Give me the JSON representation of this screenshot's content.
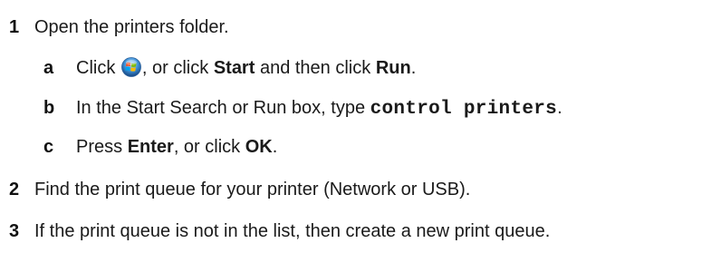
{
  "steps": [
    {
      "num": "1",
      "text": "Open the printers folder."
    },
    {
      "num": "2",
      "text": "Find the print queue for your printer (Network or USB)."
    },
    {
      "num": "3",
      "text": "If the print queue is not in the list, then create a new print queue."
    }
  ],
  "substeps": {
    "a": {
      "letter": "a",
      "pre": "Click",
      "icon": "windows-start-orb-icon",
      "mid": ", or click",
      "bold1": "Start",
      "mid2": "and then click",
      "bold2": "Run",
      "end": "."
    },
    "b": {
      "letter": "b",
      "pre": "In the Start Search or Run box, type",
      "code": "control printers",
      "end": "."
    },
    "c": {
      "letter": "c",
      "pre": "Press",
      "bold1": "Enter",
      "mid": ", or click",
      "bold2": "OK",
      "end": "."
    }
  }
}
